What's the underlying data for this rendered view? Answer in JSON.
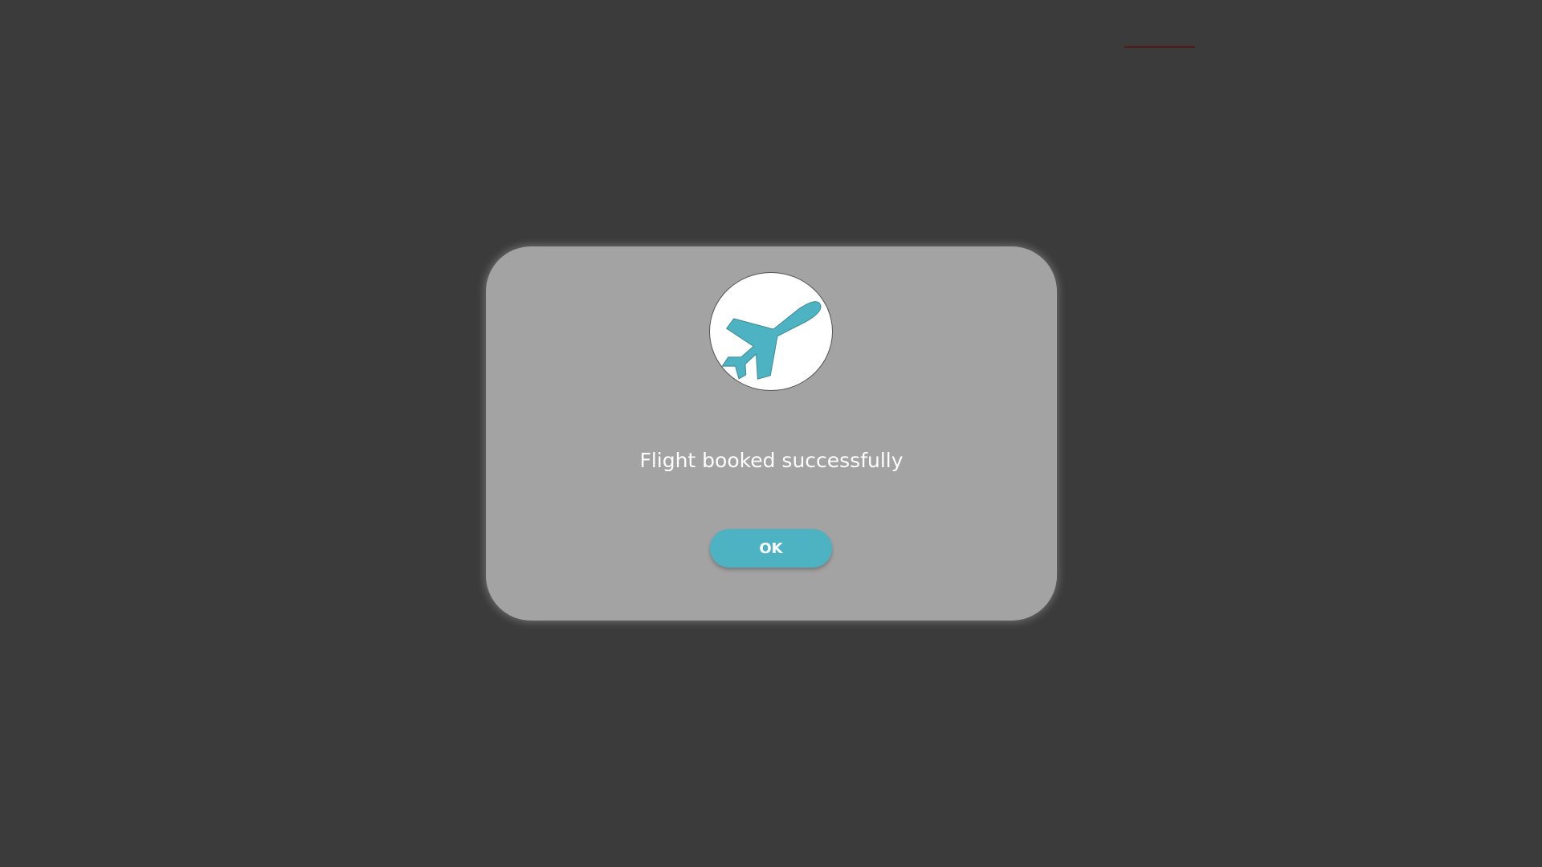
{
  "dialog": {
    "icon": "airplane-icon",
    "message": "Flight booked successfully",
    "ok_label": "OK"
  },
  "colors": {
    "background": "#3b3b3b",
    "modal": "#a3a3a3",
    "accent": "#4db3c3",
    "header_underline": "#4a1f1f"
  }
}
